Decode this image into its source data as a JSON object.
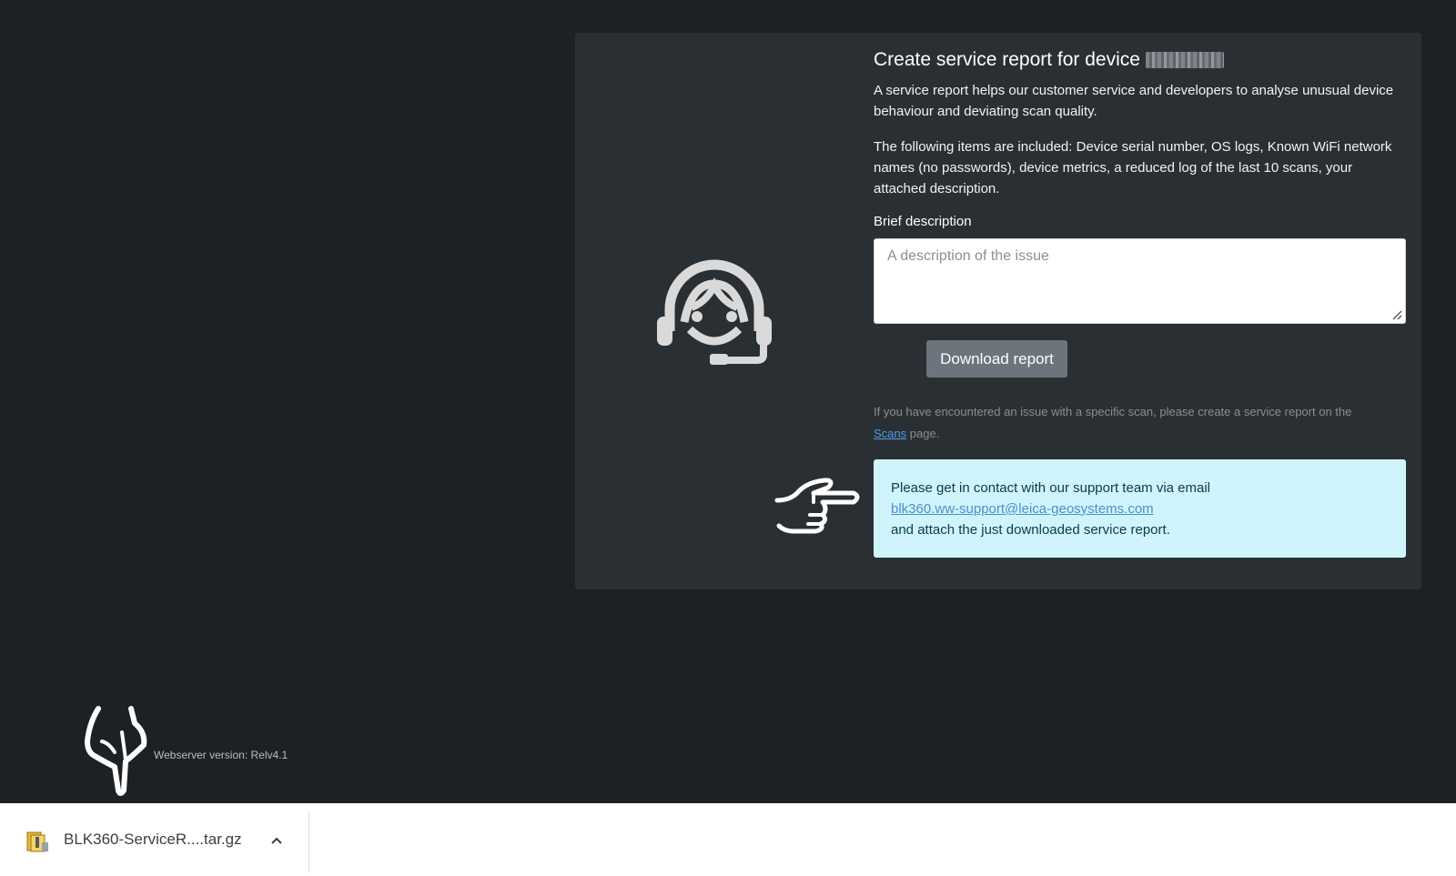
{
  "card": {
    "title": "Create service report for device",
    "intro": "A service report helps our customer service and developers to analyse unusual device behaviour and deviating scan quality.",
    "items": "The following items are included: Device serial number, OS logs, Known WiFi network names (no passwords), device metrics, a reduced log of the last 10 scans, your attached description.",
    "description_label": "Brief description",
    "description_placeholder": "A description of the issue",
    "download_label": "Download report",
    "hint_before": "If you have encountered an issue with a specific scan, please create a service report on the",
    "hint_link": "Scans",
    "hint_after": "page.",
    "contact_line1": "Please get in contact with our support team via email",
    "contact_email": "blk360.ww-support@leica-geosystems.com",
    "contact_line3": "and attach the just downloaded service report."
  },
  "footer": {
    "version": "Webserver version: Relv4.1"
  },
  "download_bar": {
    "file_name": "BLK360-ServiceR....tar.gz"
  },
  "icons": [
    "support-agent-icon",
    "pointing-hand-right-icon",
    "pointing-hand-down-icon",
    "archive-file-icon",
    "chevron-up-icon"
  ]
}
